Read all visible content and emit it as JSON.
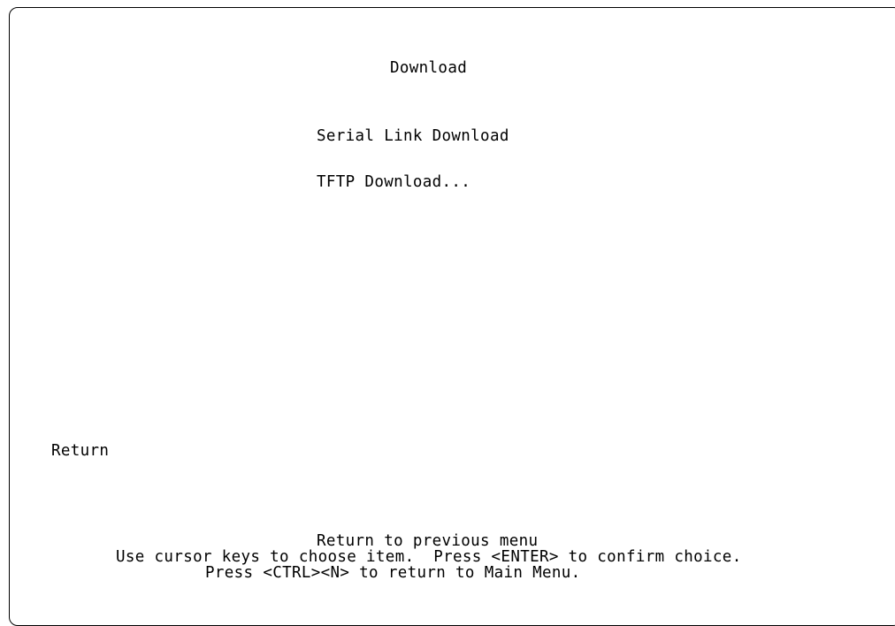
{
  "screen": {
    "title": "Download"
  },
  "menu": {
    "items": [
      {
        "label": "Serial Link Download"
      },
      {
        "label": "TFTP Download..."
      }
    ]
  },
  "return_item": {
    "label": "Return"
  },
  "help": {
    "description": "Return to previous menu",
    "instructions": "Use cursor keys to choose item.  Press <ENTER> to confirm choice.",
    "main_menu_hint": "Press <CTRL><N> to return to Main Menu."
  }
}
